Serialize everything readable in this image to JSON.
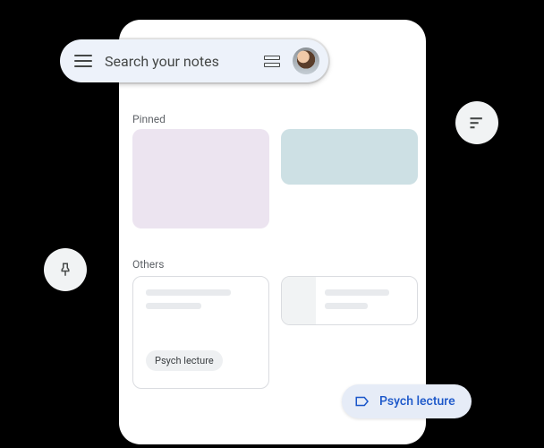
{
  "search": {
    "placeholder": "Search your notes"
  },
  "sections": {
    "pinned": "Pinned",
    "others": "Others"
  },
  "notes": {
    "card1_chip": "Psych lecture"
  },
  "label_pill": {
    "text": "Psych lecture"
  }
}
